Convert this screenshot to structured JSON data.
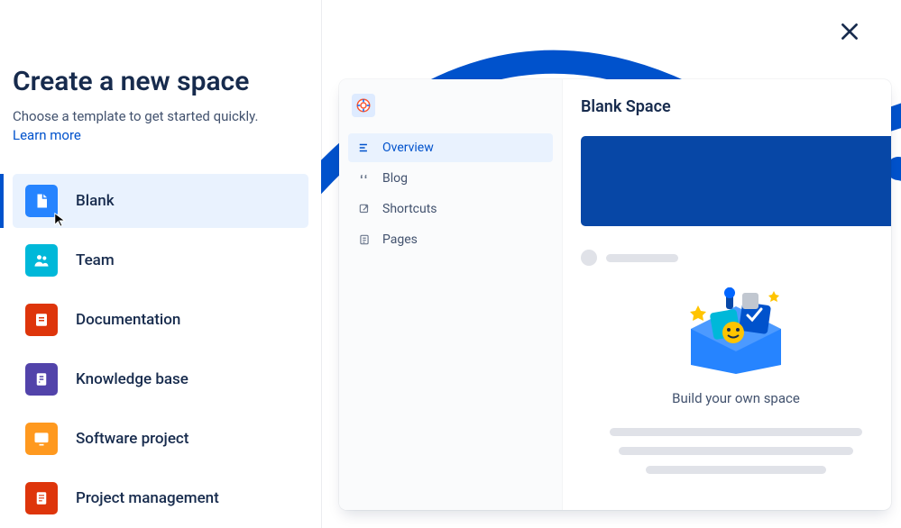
{
  "header": {
    "title": "Create a new space",
    "subtitle": "Choose a template to get started quickly.",
    "learn_more": "Learn more"
  },
  "templates": [
    {
      "id": "blank",
      "label": "Blank",
      "selected": true
    },
    {
      "id": "team",
      "label": "Team",
      "selected": false
    },
    {
      "id": "docs",
      "label": "Documentation",
      "selected": false
    },
    {
      "id": "kb",
      "label": "Knowledge base",
      "selected": false
    },
    {
      "id": "sw",
      "label": "Software project",
      "selected": false
    },
    {
      "id": "pm",
      "label": "Project management",
      "selected": false
    }
  ],
  "preview": {
    "title": "Blank Space",
    "nav": {
      "overview": "Overview",
      "blog": "Blog",
      "shortcuts": "Shortcuts",
      "pages": "Pages"
    },
    "caption": "Build your own space"
  },
  "colors": {
    "primary": "#0052CC",
    "hero": "#0747A6"
  }
}
